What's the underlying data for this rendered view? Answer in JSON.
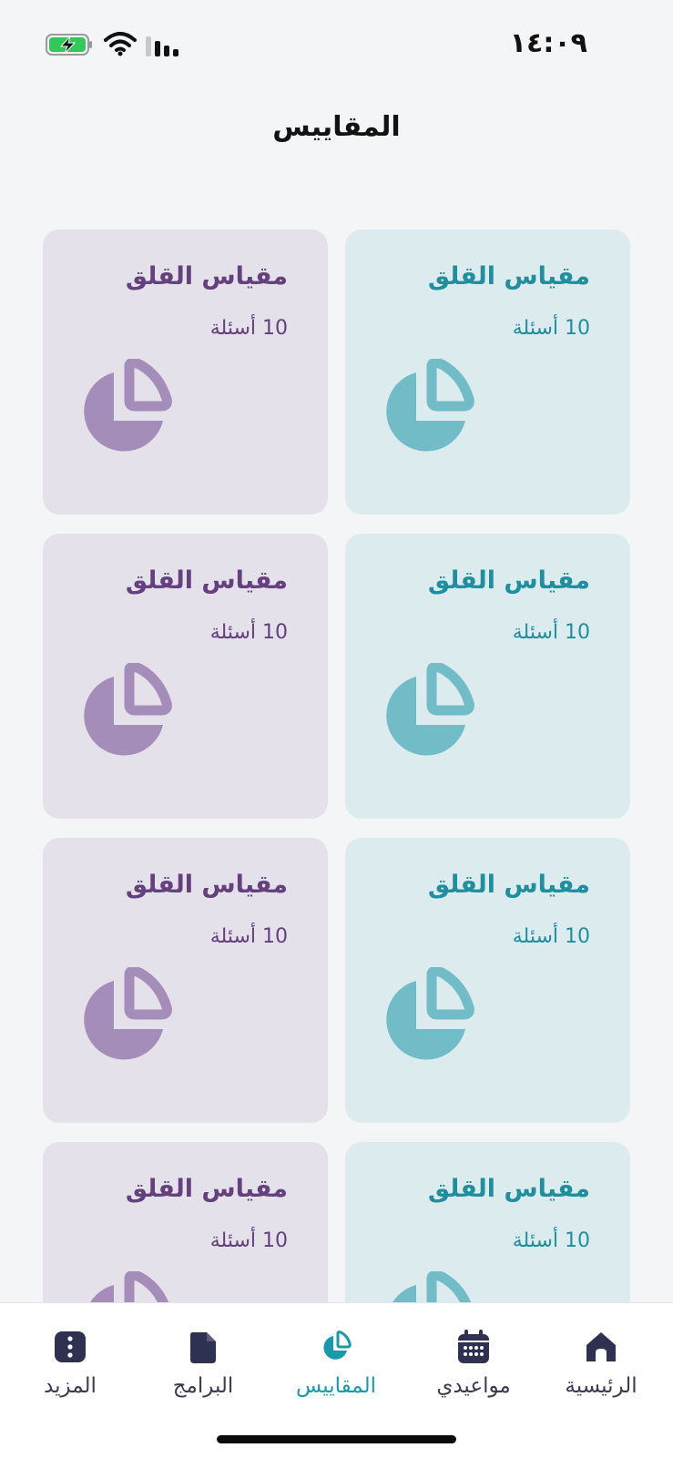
{
  "status_bar": {
    "time": "١٤:٠٩"
  },
  "header": {
    "title": "المقاييس"
  },
  "cards": [
    {
      "title": "مقياس القلق",
      "subtitle": "10 أسئلة",
      "theme": "teal"
    },
    {
      "title": "مقياس القلق",
      "subtitle": "10 أسئلة",
      "theme": "purple"
    },
    {
      "title": "مقياس القلق",
      "subtitle": "10 أسئلة",
      "theme": "teal"
    },
    {
      "title": "مقياس القلق",
      "subtitle": "10 أسئلة",
      "theme": "purple"
    },
    {
      "title": "مقياس القلق",
      "subtitle": "10 أسئلة",
      "theme": "teal"
    },
    {
      "title": "مقياس القلق",
      "subtitle": "10 أسئلة",
      "theme": "purple"
    },
    {
      "title": "مقياس القلق",
      "subtitle": "10 أسئلة",
      "theme": "teal"
    },
    {
      "title": "مقياس القلق",
      "subtitle": "10 أسئلة",
      "theme": "purple"
    }
  ],
  "colors": {
    "teal_accent": "#1f8f9f",
    "teal_icon": "#72bcc7",
    "purple_accent": "#64407f",
    "purple_icon": "#a58db9",
    "nav_active": "#1a9aa8",
    "nav_inactive": "#3b3b4f"
  },
  "bottom_nav": {
    "items": [
      {
        "label": "الرئيسية",
        "icon": "home-icon"
      },
      {
        "label": "مواعيدي",
        "icon": "calendar-icon"
      },
      {
        "label": "المقاييس",
        "icon": "pie-chart-icon",
        "active": true
      },
      {
        "label": "البرامج",
        "icon": "file-icon"
      },
      {
        "label": "المزيد",
        "icon": "more-icon"
      }
    ]
  }
}
